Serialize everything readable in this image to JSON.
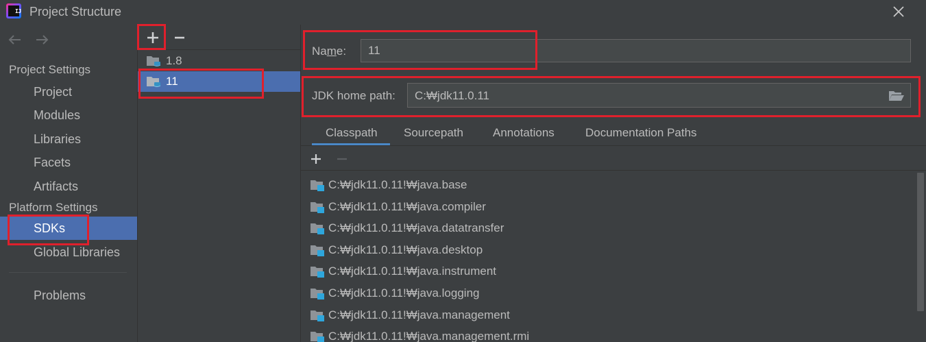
{
  "window": {
    "logo_text": "IJ",
    "title": "Project Structure",
    "close_icon": "close-icon"
  },
  "nav": {
    "back_icon": "arrow-left-icon",
    "forward_icon": "arrow-right-icon"
  },
  "sidebar": {
    "project_settings_header": "Project Settings",
    "project_settings_items": [
      {
        "label": "Project"
      },
      {
        "label": "Modules"
      },
      {
        "label": "Libraries"
      },
      {
        "label": "Facets"
      },
      {
        "label": "Artifacts"
      }
    ],
    "platform_settings_header": "Platform Settings",
    "platform_settings_items": [
      {
        "label": "SDKs",
        "selected": true
      },
      {
        "label": "Global Libraries"
      }
    ],
    "problems_label": "Problems"
  },
  "sdk_list": {
    "add_icon": "plus-icon",
    "remove_icon": "minus-icon",
    "items": [
      {
        "label": "1.8",
        "selected": false
      },
      {
        "label": "11",
        "selected": true
      }
    ]
  },
  "details": {
    "name_label_pre": "Na",
    "name_label_mnemonic": "m",
    "name_label_post": "e:",
    "name_value": "11",
    "jdk_home_label": "JDK home path:",
    "jdk_home_value": "C:₩jdk11.0.11",
    "browse_icon": "folder-open-icon",
    "tabs": [
      {
        "label": "Classpath",
        "active": true
      },
      {
        "label": "Sourcepath"
      },
      {
        "label": "Annotations"
      },
      {
        "label": "Documentation Paths"
      }
    ],
    "classpath_entries": [
      "C:₩jdk11.0.11!₩java.base",
      "C:₩jdk11.0.11!₩java.compiler",
      "C:₩jdk11.0.11!₩java.datatransfer",
      "C:₩jdk11.0.11!₩java.desktop",
      "C:₩jdk11.0.11!₩java.instrument",
      "C:₩jdk11.0.11!₩java.logging",
      "C:₩jdk11.0.11!₩java.management",
      "C:₩jdk11.0.11!₩java.management.rmi"
    ]
  },
  "colors": {
    "background": "#3c3f41",
    "selection": "#4b6eaf",
    "highlight_box": "#e0202c",
    "tab_underline": "#4a88c7"
  }
}
